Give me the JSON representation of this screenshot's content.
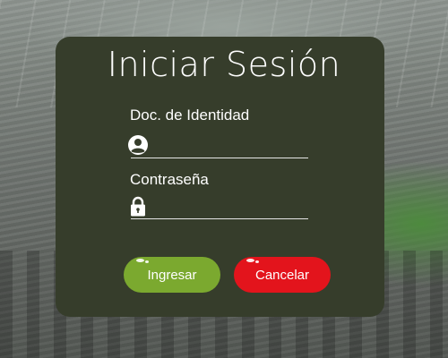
{
  "login": {
    "title": "Iniciar Sesión",
    "id_label": "Doc. de Identidad",
    "id_value": "",
    "password_label": "Contraseña",
    "password_value": "",
    "submit_label": "Ingresar",
    "cancel_label": "Cancelar"
  },
  "icons": {
    "id_icon": "user-icon",
    "password_icon": "lock-icon"
  },
  "colors": {
    "card": "#363d2b",
    "submit": "#7ba92f",
    "cancel": "#e3141c",
    "text": "#ffffff"
  }
}
